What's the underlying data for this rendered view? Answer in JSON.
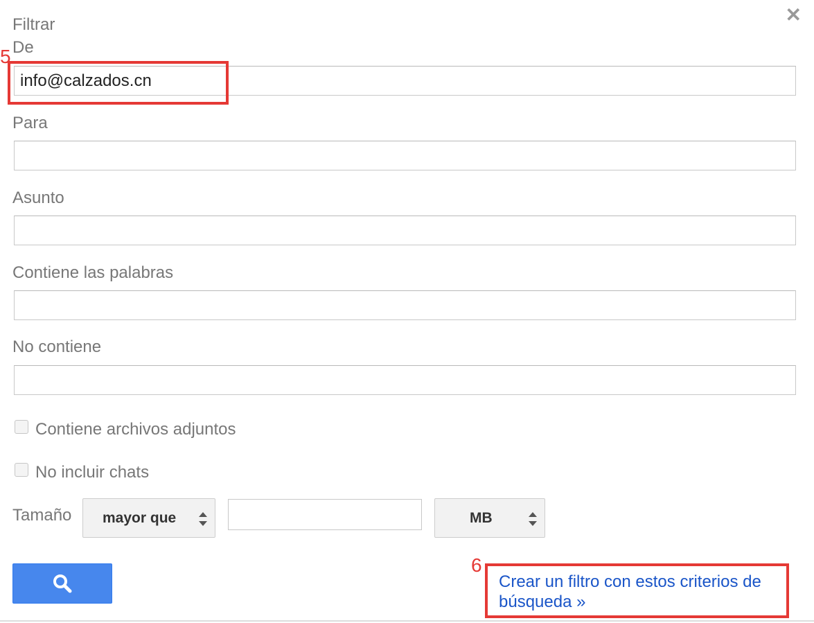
{
  "dialog": {
    "title": "Filtrar",
    "close_icon": "close-icon"
  },
  "fields": {
    "from": {
      "label": "De",
      "value": "info@calzados.cn"
    },
    "to": {
      "label": "Para",
      "value": ""
    },
    "subject": {
      "label": "Asunto",
      "value": ""
    },
    "has_words": {
      "label": "Contiene las palabras",
      "value": ""
    },
    "doesnt_have": {
      "label": "No contiene",
      "value": ""
    }
  },
  "checkboxes": {
    "has_attachment": {
      "label": "Contiene archivos adjuntos",
      "checked": false
    },
    "no_chats": {
      "label": "No incluir chats",
      "checked": false
    }
  },
  "size": {
    "label": "Tamaño",
    "operator": "mayor que",
    "value": "",
    "unit": "MB"
  },
  "search_button": {
    "icon": "search-icon"
  },
  "create_filter_link": {
    "line1": "Crear un filtro con estos criterios de",
    "line2": "búsqueda »"
  },
  "annotations": {
    "marker_5": "5",
    "marker_6": "6",
    "color": "#e53935"
  }
}
